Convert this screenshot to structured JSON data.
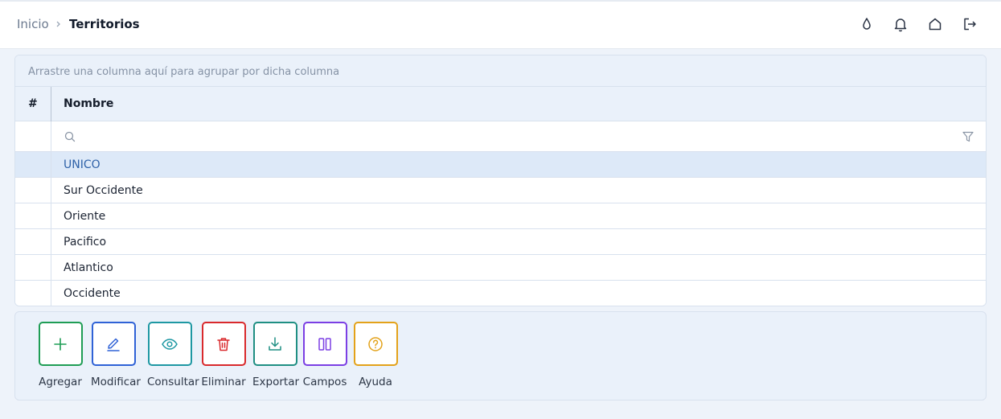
{
  "breadcrumb": {
    "home": "Inicio",
    "current": "Territorios"
  },
  "header_icons": [
    "drop-icon",
    "bell-icon",
    "home-icon",
    "logout-icon"
  ],
  "grid": {
    "group_panel_text": "Arrastre una columna aquí para agrupar por dicha columna",
    "columns": [
      "#",
      "Nombre"
    ],
    "rows": [
      "UNICO",
      "Sur Occidente",
      "Oriente",
      "Pacifico",
      "Atlantico",
      "Occidente"
    ],
    "selected_row": "UNICO"
  },
  "toolbar": {
    "add": "Agregar",
    "edit": "Modificar",
    "view": "Consultar",
    "delete": "Eliminar",
    "export": "Exportar",
    "fields": "Campos",
    "help": "Ayuda"
  },
  "colors": {
    "add": "#1f9d55",
    "edit": "#2f62d6",
    "view": "#1e98a3",
    "delete": "#d9292c",
    "export": "#1f8f83",
    "fields": "#7b3fe4",
    "help": "#e3a21a",
    "selected_row_bg": "#dde9f8"
  }
}
